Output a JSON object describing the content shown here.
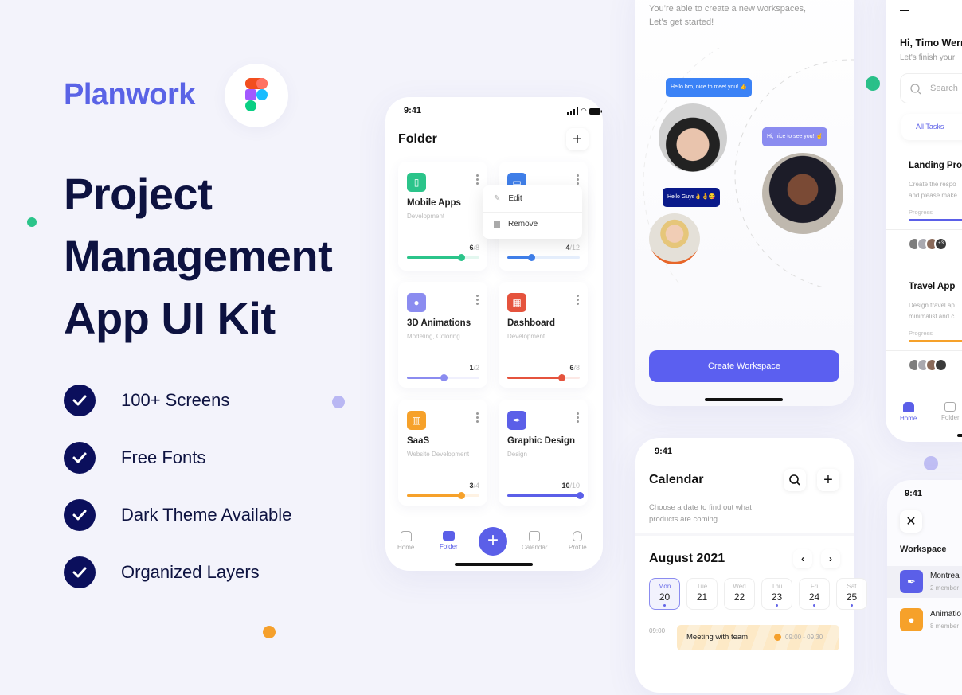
{
  "colors": {
    "brand": "#5a63e6",
    "navy": "#0b0f5c",
    "accent": "#5b5ff0",
    "green": "#2bc48a",
    "blue": "#3f7ee8",
    "lavender": "#8b8cf0",
    "red": "#e5533d",
    "orange": "#f6a12a",
    "indigo": "#5b5fe8"
  },
  "promo": {
    "brand": "Planwork",
    "logo": "figma-logo",
    "headline": [
      "Project",
      "Management",
      "App UI Kit"
    ],
    "features": [
      "100+ Screens",
      "Free Fonts",
      "Dark Theme Available",
      "Organized Layers"
    ]
  },
  "status_time": "9:41",
  "folder_screen": {
    "title": "Folder",
    "cards": [
      {
        "title": "Mobile Apps",
        "subtitle": "Development",
        "done": 6,
        "total": 8,
        "color": "#2bc48a",
        "icon": "phone-icon"
      },
      {
        "title": "",
        "subtitle": "",
        "done": 4,
        "total": 12,
        "color": "#3f7ee8",
        "icon": "monitor-icon"
      },
      {
        "title": "3D Animations",
        "subtitle": "Modeling, Coloring",
        "done": 1,
        "total": 2,
        "color": "#8b8cf0",
        "icon": "balloon-icon"
      },
      {
        "title": "Dashboard",
        "subtitle": "Development",
        "done": 6,
        "total": 8,
        "color": "#e5533d",
        "icon": "grid-icon"
      },
      {
        "title": "SaaS",
        "subtitle": "Website Development",
        "done": 3,
        "total": 4,
        "color": "#f6a12a",
        "icon": "chart-icon"
      },
      {
        "title": "Graphic Design",
        "subtitle": "Design",
        "done": 10,
        "total": 10,
        "color": "#5b5fe8",
        "icon": "pen-icon"
      }
    ],
    "context_menu": {
      "edit": "Edit",
      "remove": "Remove"
    },
    "nav": {
      "home": "Home",
      "folder": "Folder",
      "calendar": "Calendar",
      "profile": "Profile",
      "active": "Folder"
    }
  },
  "workspace_screen": {
    "intro": [
      "You’re able to create a new workspaces,",
      "Let’s get started!"
    ],
    "bubbles": [
      "Hello bro, nice to meet you! 👍",
      "Hi, nice to see you! ✌",
      "Hello Guys👌👌😋"
    ],
    "button": "Create Workspace"
  },
  "calendar_screen": {
    "title": "Calendar",
    "description": [
      "Choose a date to find out what",
      "products are coming"
    ],
    "month": "August 2021",
    "days": [
      {
        "name": "Mon",
        "date": "20",
        "dot": true,
        "selected": true
      },
      {
        "name": "Tue",
        "date": "21",
        "dot": false
      },
      {
        "name": "Wed",
        "date": "22",
        "dot": false
      },
      {
        "name": "Thu",
        "date": "23",
        "dot": true
      },
      {
        "name": "Fri",
        "date": "24",
        "dot": true
      },
      {
        "name": "Sat",
        "date": "25",
        "dot": true
      }
    ],
    "event": {
      "time": "09:00",
      "title": "Meeting with team",
      "range": "09:00 - 09.30"
    }
  },
  "home_screen": {
    "greeting": "Hi, Timo Wern",
    "subgreeting": "Let's finish your",
    "search_placeholder": "Search",
    "tab": "All Tasks",
    "tasks": [
      {
        "title": "Landing Proj",
        "desc": [
          "Create the respo",
          "and please make"
        ],
        "progress_label": "Progress",
        "color": "#5b5fe8",
        "extra": "+3"
      },
      {
        "title": "Travel App",
        "desc": [
          "Design travel ap",
          "minimalist and c"
        ],
        "progress_label": "Progress",
        "color": "#f6a12a",
        "extra": ""
      }
    ],
    "nav": {
      "home": "Home",
      "folder": "Folder"
    }
  },
  "workspace_list": {
    "title": "Workspace",
    "items": [
      {
        "name": "Montrea",
        "members": "2 member",
        "color": "#5b5fe8"
      },
      {
        "name": "Animatio",
        "members": "8 member",
        "color": "#f6a12a"
      }
    ]
  }
}
